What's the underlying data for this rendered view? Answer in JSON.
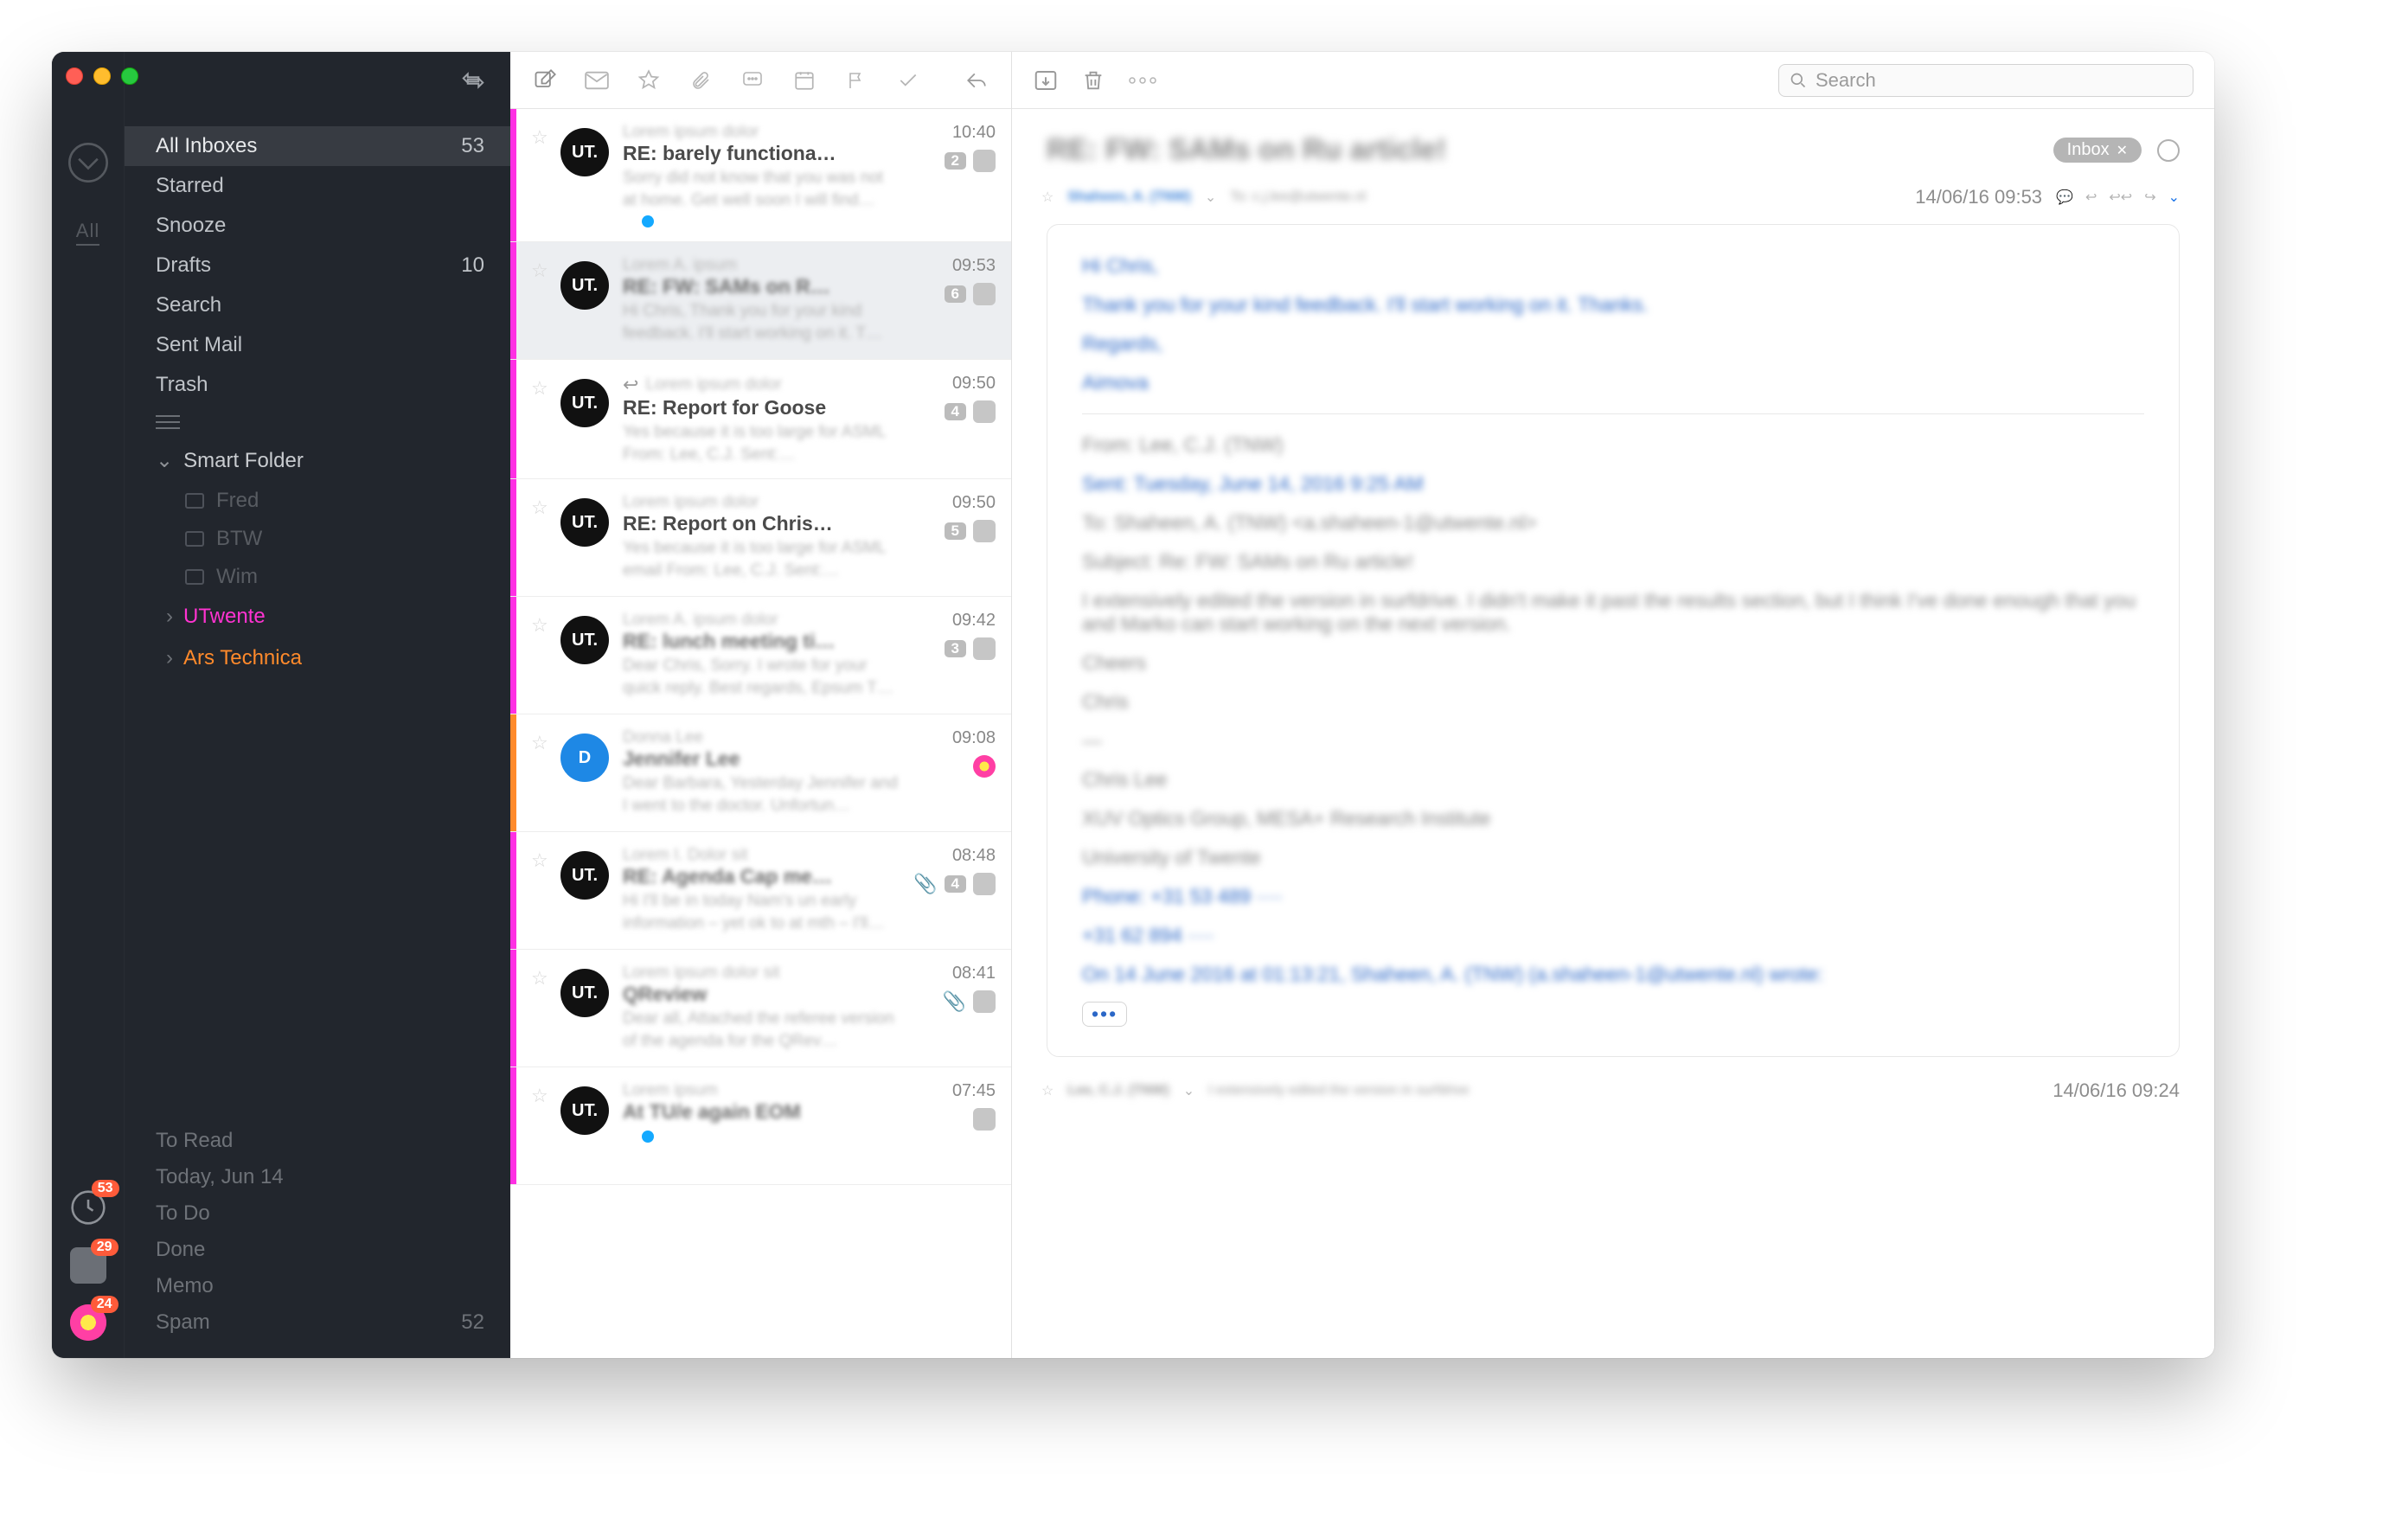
{
  "sidebar": {
    "nav": [
      {
        "label": "All Inboxes",
        "count": "53",
        "selected": true
      },
      {
        "label": "Starred"
      },
      {
        "label": "Snooze"
      },
      {
        "label": "Drafts",
        "count": "10"
      },
      {
        "label": "Search"
      },
      {
        "label": "Sent Mail"
      },
      {
        "label": "Trash"
      }
    ],
    "smart_folder_label": "Smart Folder",
    "smart_children": [
      "Fred",
      "BTW",
      "Wim"
    ],
    "accounts": [
      {
        "label": "UTwente",
        "cls": "utw"
      },
      {
        "label": "Ars Technica",
        "cls": "ars"
      }
    ],
    "rail_badges": [
      "53",
      "29",
      "24"
    ],
    "bottom": [
      {
        "label": "To Read"
      },
      {
        "label": "Today, Jun 14"
      },
      {
        "label": "To Do"
      },
      {
        "label": "Done"
      },
      {
        "label": "Memo"
      },
      {
        "label": "Spam",
        "count": "52"
      }
    ]
  },
  "messages": [
    {
      "color": "#ff2fe3",
      "av": "UT.",
      "sender": "Lorem ipsum dolor",
      "subject": "RE: barely functiona…",
      "preview": "Sorry did not know that you was not at home. Get well soon I will find…",
      "time": "10:40",
      "count": "2",
      "tiny": "av",
      "dot": true
    },
    {
      "color": "#ff2fe3",
      "av": "UT.",
      "sender": "Lorem A. ipsum",
      "subject": "RE: FW: SAMs on R…",
      "preview": "Hi Chris, Thank you for your kind feedback. I'll start working on it. T…",
      "time": "09:53",
      "count": "6",
      "tiny": "av",
      "selected": true,
      "blurSubj": true
    },
    {
      "color": "#ff2fe3",
      "av": "UT.",
      "sender": "Lorem ipsum dolor",
      "subject": "RE: Report for Goose",
      "preview": "Yes because it is too large for ASML From: Lee, C.J. Sent:…",
      "time": "09:50",
      "count": "4",
      "tiny": "av",
      "reply": true
    },
    {
      "color": "#ff2fe3",
      "av": "UT.",
      "sender": "Lorem ipsum dolor",
      "subject": "RE: Report on Chris…",
      "preview": "Yes because it is too large for ASML email From: Lee, C.J. Sent:…",
      "time": "09:50",
      "count": "5",
      "tiny": "av"
    },
    {
      "color": "#ff2fe3",
      "av": "UT.",
      "sender": "Lorem A. ipsum dolor",
      "subject": "RE: lunch meeting ti…",
      "preview": "Dear Chris, Sorry. I wrote for your quick reply. Best regards, Epsum T…",
      "time": "09:42",
      "count": "3",
      "tiny": "av",
      "blurSubj": true
    },
    {
      "color": "#ff8a2b",
      "av": "D",
      "avcls": "d",
      "sender": "Donna Lee",
      "subject": "Jennifer Lee",
      "preview": "Dear Barbara, Yesterday Jennifer and I went to the doctor. Unfortun…",
      "time": "09:08",
      "tiny": "flower",
      "blurSubj": true
    },
    {
      "color": "#ff2fe3",
      "av": "UT.",
      "sender": "Lorem I. Dolor sit",
      "subject": "RE: Agenda Cap me…",
      "preview": "Hi I'll be in today Nam's un early information – yet ok to at mth – I'll…",
      "time": "08:48",
      "count": "4",
      "tiny": "av",
      "clip": true,
      "blurSubj": true
    },
    {
      "color": "#ff2fe3",
      "av": "UT.",
      "sender": "Lorem ipsum dolor sit",
      "subject": "QReview",
      "preview": "Dear all, Attached the referee version of the agenda for the QRev…",
      "time": "08:41",
      "tiny": "av",
      "clip": true,
      "blurSubj": true
    },
    {
      "color": "#ff2fe3",
      "av": "UT.",
      "sender": "Lorem ipsum",
      "subject": "At TU/e again EOM",
      "preview": "",
      "time": "07:45",
      "dot": true,
      "blurSubj": true
    }
  ],
  "reader": {
    "title": "RE: FW: SAMs on Ru article!",
    "inbox_label": "Inbox",
    "from": "Shaheen, A. (TNW)",
    "to": "To: c.j.lee@utwente.nl",
    "date": "14/06/16 09:53",
    "body_lines": [
      {
        "t": "Hi Chris,",
        "c": "blue"
      },
      {
        "t": "Thank you for your kind feedback. I'll start working on it. Thanks.",
        "c": "blue"
      },
      {
        "t": "Regards,",
        "c": "blue"
      },
      {
        "t": "Aimova",
        "c": "blue"
      },
      {
        "hr": true
      },
      {
        "t": "From: Lee, C.J. (TNW)"
      },
      {
        "t": "Sent: Tuesday, June 14, 2016 9:25 AM",
        "c": "blue"
      },
      {
        "t": "To: Shaheen, A. (TNW) <a.shaheen-1@utwente.nl>"
      },
      {
        "t": "Subject: Re: FW: SAMs on Ru article!"
      },
      {
        "t": "I extensively edited the version in surfdrive. I didn't make it past the results section, but I think I've done enough that you and Marko can start working on the next version."
      },
      {
        "t": "Cheers"
      },
      {
        "t": "Chris"
      },
      {
        "t": "—"
      },
      {
        "t": "Chris Lee"
      },
      {
        "t": "XUV Optics Group, MESA+ Research Institute"
      },
      {
        "t": "University of Twente"
      },
      {
        "t": "Phone: +31 53 489 ····",
        "c": "blue"
      },
      {
        "t": "          +31 62 894 ····",
        "c": "blue"
      },
      {
        "t": "On 14 June 2016 at 01:13:21, Shaheen, A. (TNW) (a.shaheen-1@utwente.nl) wrote:",
        "c": "blue"
      }
    ],
    "prev": {
      "from": "Lee, C.J. (TNW)",
      "sub": "I extensively edited the version in surfdrive",
      "date": "14/06/16 09:24"
    },
    "search_placeholder": "Search"
  }
}
